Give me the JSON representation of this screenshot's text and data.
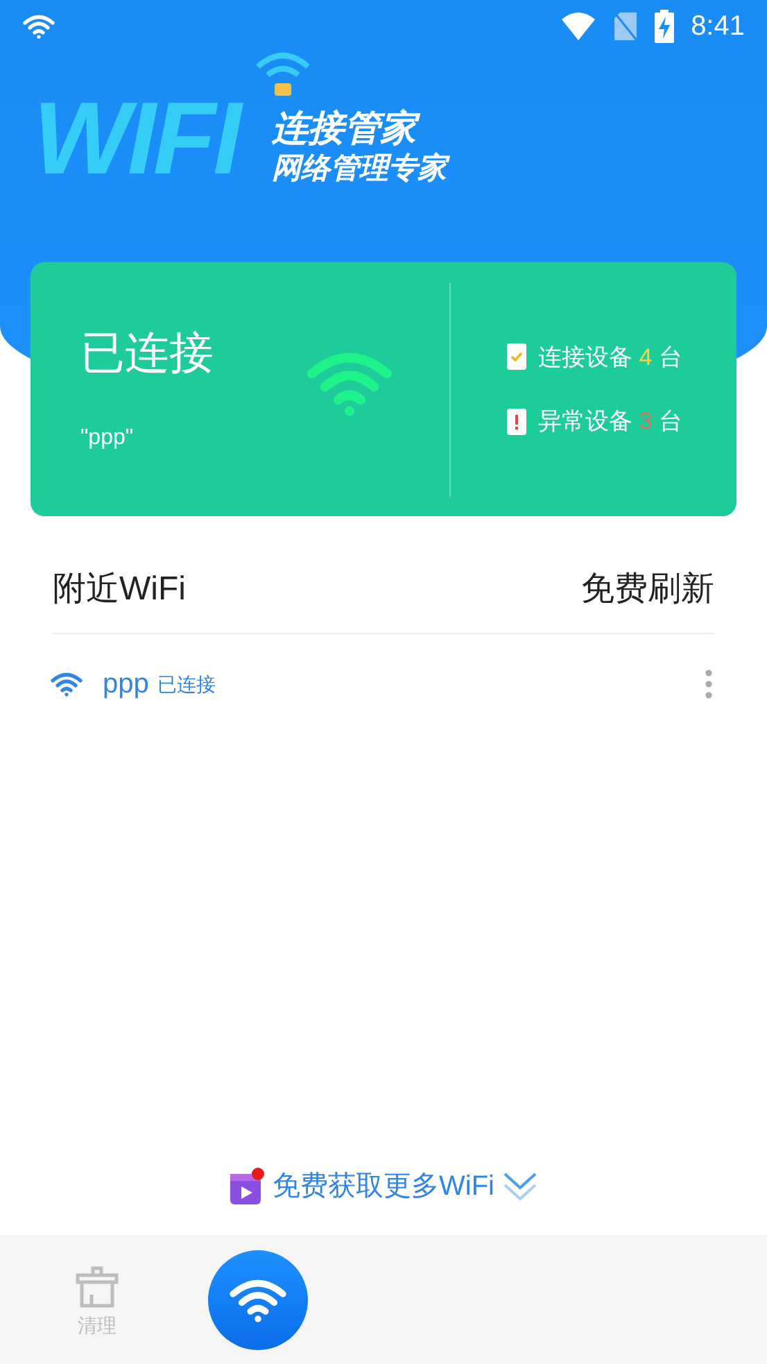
{
  "status_bar": {
    "time": "8:41"
  },
  "header": {
    "logo": "WIFI",
    "title": "连接管家",
    "subtitle": "网络管理专家"
  },
  "card": {
    "status": "已连接",
    "ssid": "\"ppp\"",
    "stats": [
      {
        "kind": "ok",
        "label": "连接设备",
        "count": "4",
        "unit": "台",
        "color": "#f5d547"
      },
      {
        "kind": "alert",
        "label": "异常设备",
        "count": "3",
        "unit": "台",
        "color": "#d9735c"
      }
    ]
  },
  "nearby": {
    "title": "附近WiFi",
    "action": "免费刷新",
    "networks": [
      {
        "name": "ppp",
        "status": "已连接"
      }
    ]
  },
  "promo": {
    "text": "免费获取更多WiFi"
  },
  "bottom_nav": [
    {
      "kind": "clean",
      "label": "清理",
      "selected": false
    },
    {
      "kind": "wifi",
      "selected": true
    }
  ]
}
